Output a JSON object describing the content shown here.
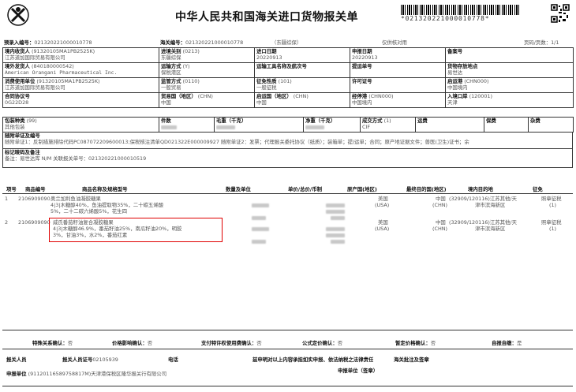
{
  "header": {
    "title": "中华人民共和国海关进口货物报关单",
    "barcode_text": "*021320221000010778*",
    "pre_entry_label": "预录入编号：",
    "pre_entry_no": "021320221000010778",
    "customs_no_label": "海关编号：",
    "customs_no": "021320221000010778",
    "customs_name": "（东疆综保）",
    "verify_note": "仅供核对用",
    "page_info": "页码/页数：1/1"
  },
  "rows": {
    "consignee_label": "境内收货人",
    "consignee_code": "(91320105MA1PB2525K)",
    "consignee_name": "江苏道加国际贸易有限公司",
    "entry_customs_label": "进境关别",
    "entry_customs_code": "(0213)",
    "entry_customs_name": "东疆综保",
    "import_date_label": "进口日期",
    "import_date": "20220913",
    "declare_date_label": "申报日期",
    "declare_date": "20220913",
    "record_no_label": "备案号",
    "record_no": "",
    "shipper_label": "境外发货人",
    "shipper_code": "(840180000542)",
    "shipper_name": "American Orangani Pharmaceutical Inc.",
    "transport_mode_label": "运输方式",
    "transport_mode_code": "(Y)",
    "transport_mode_name": "保税港区",
    "vessel_label": "运输工具名称及航次号",
    "vessel": "",
    "bl_label": "提运单号",
    "bl_no": "",
    "storage_label": "货物存放地点",
    "storage": "易世达",
    "consumer_label": "消费使用单位",
    "consumer_code": "(91320105MA1PB2525K)",
    "consumer_name": "江苏道加国际贸易有限公司",
    "supervision_label": "监管方式",
    "supervision_code": "(0110)",
    "supervision_name": "一般贸易",
    "tax_nature_label": "征免性质",
    "tax_nature_code": "(101)",
    "tax_nature_name": "一般征税",
    "license_label": "许可证号",
    "license_no": "",
    "departure_port_label": "启运港",
    "departure_port_code": "(CHN000)",
    "departure_port_name": "中国境内",
    "contract_label": "合同协议号",
    "contract_no": "0G22D28",
    "trade_country_label": "贸易国（地区）",
    "trade_country_code": "(CHN)",
    "trade_country_name": "中国",
    "origin_country_label": "启运国（地区）",
    "origin_country_code": "(CHN)",
    "origin_country_name": "中国",
    "transit_port_label": "经停港",
    "transit_port_code": "(CHN000)",
    "transit_port_name": "中国境内",
    "entry_port_label": "入境口岸",
    "entry_port_code": "(120001)",
    "entry_port_name": "天津",
    "packing_label": "包装种类",
    "packing_code": "(99)",
    "packing_name": "其他包装",
    "pieces_label": "件数",
    "gross_label": "毛重（千克）",
    "net_label": "净重（千克）",
    "deal_mode_label": "成交方式",
    "deal_mode_code": "(1)",
    "deal_mode_name": "CIF",
    "freight_label": "运费",
    "insurance_label": "保费",
    "misc_label": "杂费"
  },
  "docs": {
    "label": "随附单证及编号",
    "line": "随附单证1：反制措施排除代码PC087072209600013;保税核注清单QD021322E000009927 随附单证2：发票；代理报关委托协议（纸质）；装箱单；提/运单；合同；原产地证据文件；兽医(卫生)证书；余"
  },
  "marks": {
    "label": "标记唛码及备注",
    "remark": "备注：易世达库 N/M  关联报关单号：021320221000010519"
  },
  "goods_header": [
    "项号",
    "商品编号",
    "商品名称及规格型号",
    "数量及单位",
    "单价/总价/币制",
    "原产国(地区)",
    "最终目的国(地区)",
    "境内目的地",
    "征免"
  ],
  "goods": [
    {
      "no": "1",
      "code": "2106909090",
      "name": "奥兰加利鱼油凝胶糖果",
      "spec1": "4|3|木糖醇40%，鱼油提取物35%，二十碳五烯酸",
      "spec2": "5%，二十二碳六烯酸5%，花生四",
      "origin_country": "美国",
      "origin_code": "(USA)",
      "dest_country": "中国",
      "dest_code": "(CHN)",
      "domestic_dest": "(32909/120116)江苏其他/天",
      "domestic_dest2": "津市滨海新区",
      "tax": "照章征税",
      "tax_code": "(1)"
    },
    {
      "no": "2",
      "code": "2106909090",
      "name": "威氏番茄籽油复合凝胶糖果",
      "spec1": "4|3|木糖醇46.9%，番茄籽油25%，南瓜籽油20%，明胶",
      "spec2": "3%，甘油3%，水2%，番茄红素",
      "origin_country": "美国",
      "origin_code": "(USA)",
      "dest_country": "中国",
      "dest_code": "(CHN)",
      "domestic_dest": "(32909/120116)江苏其他/天",
      "domestic_dest2": "津市滨海新区",
      "tax": "照章征税",
      "tax_code": "(1)"
    }
  ],
  "confirm": {
    "special_label": "特殊关系确认：",
    "special": "否",
    "price_label": "价格影响确认：",
    "price": "否",
    "royalty_label": "支付特许权使用费确认：",
    "royalty": "否",
    "formula_label": "公式定价确认：",
    "formula": "否",
    "provisional_label": "暂定价格确认：",
    "provisional": "否",
    "self_label": "自报自缴：",
    "self": "是"
  },
  "footer": {
    "declarant_label": "报关人员",
    "declarant_cert_label": "报关人员证号",
    "declarant_cert": "02105939",
    "phone_label": "电话",
    "statement": "兹申明对以上内容承担如实申报、依法纳税之法律责任",
    "customs_remark_label": "海关批注及签章",
    "unit_label": "申报单位",
    "unit": "(91120116589758817M)天津港保税区隆华报关行有限公司",
    "unit_stamp_label": "申报单位（签章）"
  },
  "colors": {
    "highlight_box": "#e00000"
  }
}
